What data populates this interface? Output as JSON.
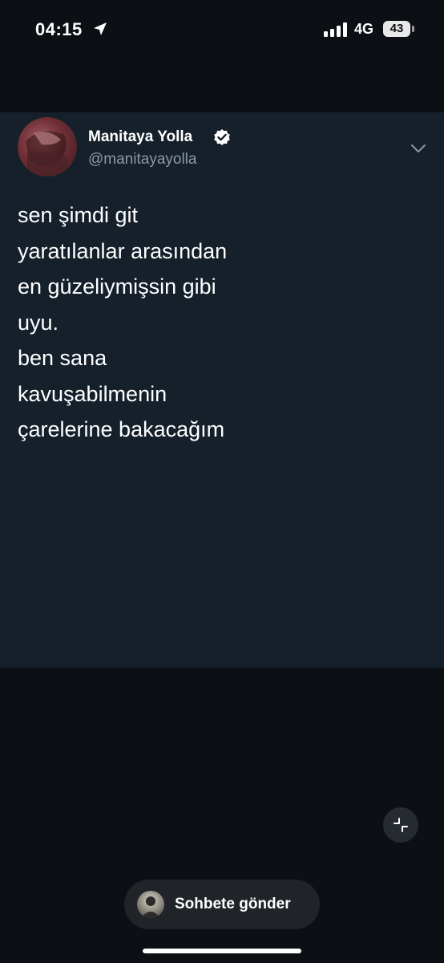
{
  "status_bar": {
    "time": "04:15",
    "location_icon": "location-arrow-icon",
    "signal_icon": "cellular-signal-icon",
    "network": "4G",
    "battery": "43"
  },
  "tweet": {
    "author_name": "Manitaya Yolla",
    "author_handle": "@manitayayolla",
    "verified_icon": "verified-badge-icon",
    "menu_icon": "chevron-down-icon",
    "lines": [
      "sen şimdi git",
      "yaratılanlar arasından",
      "en güzeliymişsin gibi",
      "uyu.",
      "ben sana",
      "kavuşabilmenin",
      "çarelerine bakacağım"
    ]
  },
  "controls": {
    "collapse_icon": "collapse-icon",
    "send_button_label": "Sohbete gönder"
  },
  "colors": {
    "background": "#0c0f14",
    "card": "#15202b",
    "handle_text": "#8b98a5",
    "pill": "#202428"
  }
}
